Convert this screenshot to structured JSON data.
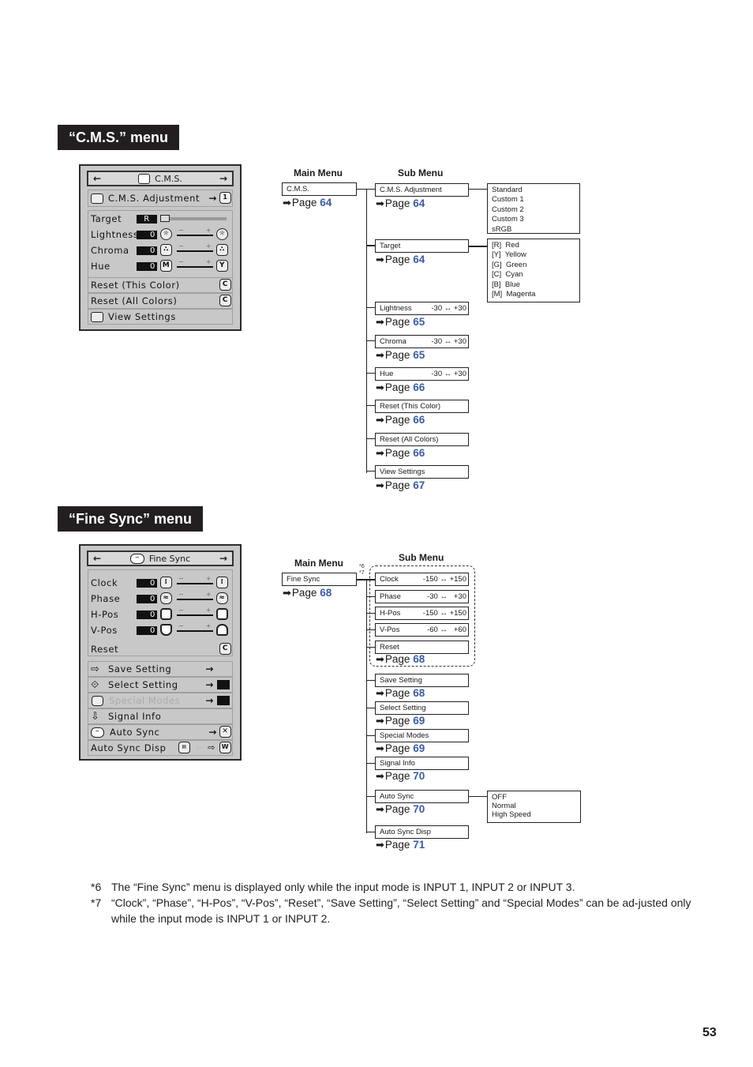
{
  "cms_section": {
    "title": "“C.M.S.” menu",
    "osd": {
      "header": {
        "left_arrow": "←",
        "icon": "cms-icon",
        "title": "C.M.S.",
        "right_arrow": "→"
      },
      "adjustment": {
        "label": "C.M.S. Adjustment",
        "arrow": "→",
        "badge": "1"
      },
      "rows": [
        {
          "label": "Target",
          "value": "R"
        },
        {
          "label": "Lightness",
          "value": "0",
          "left_icon": "sun-icon",
          "right_icon": "sun-icon"
        },
        {
          "label": "Chroma",
          "value": "0",
          "left_icon": "chroma-icon",
          "right_icon": "chroma-icon"
        },
        {
          "label": "Hue",
          "value": "0",
          "left_icon_text": "M",
          "right_icon_text": "Y"
        }
      ],
      "reset_this": "Reset (This Color)",
      "reset_all": "Reset (All Colors)",
      "reset_icon": "C",
      "view_settings": "View Settings"
    },
    "tree": {
      "main_menu_header": "Main Menu",
      "sub_menu_header": "Sub Menu",
      "main": {
        "label": "C.M.S.",
        "page": "64"
      },
      "page_prefix": "Page",
      "sub_items": [
        {
          "label": "C.M.S. Adjustment",
          "range": "",
          "page": "64"
        },
        {
          "label": "Target",
          "range": "",
          "page": "64"
        },
        {
          "label": "Lightness",
          "range": "-30 ↔ +30",
          "page": "65"
        },
        {
          "label": "Chroma",
          "range": "-30 ↔ +30",
          "page": "65"
        },
        {
          "label": "Hue",
          "range": "-30 ↔ +30",
          "page": "66"
        },
        {
          "label": "Reset (This Color)",
          "range": "",
          "page": "66"
        },
        {
          "label": "Reset (All Colors)",
          "range": "",
          "page": "66"
        },
        {
          "label": "View Settings",
          "range": "",
          "page": "67"
        }
      ],
      "adjustment_options": [
        "Standard",
        "Custom 1",
        "Custom 2",
        "Custom 3",
        "sRGB"
      ],
      "target_options": [
        "[R]  Red",
        "[Y]  Yellow",
        "[G]  Green",
        "[C]  Cyan",
        "[B]  Blue",
        "[M]  Magenta"
      ]
    }
  },
  "finesync_section": {
    "title": "“Fine Sync” menu",
    "osd": {
      "header": {
        "left_arrow": "←",
        "icon": "fine-sync-icon",
        "title": "Fine Sync",
        "right_arrow": "→"
      },
      "rows": [
        {
          "label": "Clock",
          "value": "0"
        },
        {
          "label": "Phase",
          "value": "0"
        },
        {
          "label": "H-Pos",
          "value": "0"
        },
        {
          "label": "V-Pos",
          "value": "0"
        }
      ],
      "reset": "Reset",
      "reset_icon": "C",
      "items": [
        {
          "label": "Save Setting",
          "icon": "save-setting-icon",
          "arrow": "→",
          "disabled": false
        },
        {
          "label": "Select Setting",
          "icon": "select-setting-icon",
          "arrow": "→",
          "disabled": false
        },
        {
          "label": "Special Modes",
          "icon": "special-modes-icon",
          "arrow": "→",
          "disabled": true
        },
        {
          "label": "Signal Info",
          "icon": "signal-info-icon",
          "arrow": "",
          "disabled": false
        },
        {
          "label": "Auto Sync",
          "icon": "auto-sync-icon",
          "arrow": "→",
          "disabled": false
        }
      ],
      "auto_sync_disp": "Auto Sync Disp"
    },
    "tree": {
      "main_menu_header": "Main Menu",
      "sub_menu_header": "Sub Menu",
      "notes_marks": [
        "*6",
        "*7"
      ],
      "main": {
        "label": "Fine Sync",
        "page": "68"
      },
      "page_prefix": "Page",
      "grouped_items": [
        {
          "label": "Clock",
          "range": "-150 ↔ +150"
        },
        {
          "label": "Phase",
          "range": "-30 ↔   +30"
        },
        {
          "label": "H-Pos",
          "range": "-150 ↔ +150"
        },
        {
          "label": "V-Pos",
          "range": "-60 ↔   +60"
        },
        {
          "label": "Reset",
          "range": ""
        }
      ],
      "grouped_page": "68",
      "sub_items": [
        {
          "label": "Save Setting",
          "page": "68"
        },
        {
          "label": "Select Setting",
          "page": "69"
        },
        {
          "label": "Special Modes",
          "page": "69"
        },
        {
          "label": "Signal Info",
          "page": "70"
        },
        {
          "label": "Auto Sync",
          "page": "70"
        },
        {
          "label": "Auto Sync Disp",
          "page": "71"
        }
      ],
      "auto_sync_options": [
        "OFF",
        "Normal",
        "High Speed"
      ]
    }
  },
  "footnotes": [
    {
      "mark": "*6",
      "text": "The “Fine Sync” menu is displayed only while the input mode is INPUT 1, INPUT 2 or INPUT 3."
    },
    {
      "mark": "*7",
      "text": "“Clock”, “Phase”, “H-Pos”, “V-Pos”, “Reset”, “Save Setting”, “Select Setting” and “Special Modes” can be ad-justed only while the input mode is INPUT 1 or INPUT 2."
    }
  ],
  "page_number": "53",
  "colors": {
    "page_link": "#3a5ba8",
    "title_bg": "#231f20"
  }
}
